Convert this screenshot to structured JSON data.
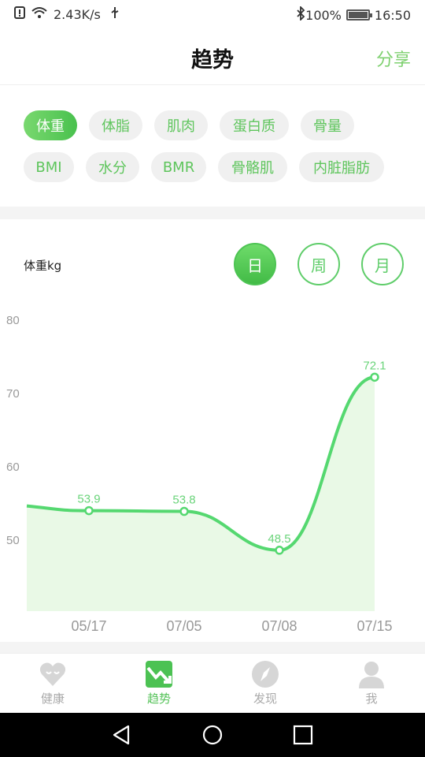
{
  "status_bar": {
    "speed": "2.43K/s",
    "battery": "100%",
    "time": "16:50"
  },
  "header": {
    "title": "趋势",
    "share": "分享"
  },
  "chips": {
    "row1": [
      "体重",
      "体脂",
      "肌肉",
      "蛋白质",
      "骨量"
    ],
    "row2": [
      "BMI",
      "水分",
      "BMR",
      "骨骼肌",
      "内脏脂肪"
    ],
    "active": "体重"
  },
  "chart_header": {
    "label": "体重kg",
    "periods": [
      "日",
      "周",
      "月"
    ],
    "active_period": "日"
  },
  "chart_data": {
    "type": "area",
    "title": "",
    "xlabel": "",
    "ylabel": "体重kg",
    "categories": [
      "05/17",
      "07/05",
      "07/08",
      "07/15"
    ],
    "series": [
      {
        "values": [
          53.9,
          53.8,
          48.5,
          72.1
        ]
      }
    ],
    "y_ticks": [
      80,
      70,
      60,
      50
    ],
    "ylim": [
      40.2,
      80
    ],
    "line_color": "#55d870",
    "fill_color": "#e9f9e6",
    "grid": false
  },
  "tabs": [
    {
      "label": "健康",
      "icon": "heart-icon",
      "active": false
    },
    {
      "label": "趋势",
      "icon": "trend-icon",
      "active": true
    },
    {
      "label": "发现",
      "icon": "compass-icon",
      "active": false
    },
    {
      "label": "我",
      "icon": "person-icon",
      "active": false
    }
  ],
  "colors": {
    "accent": "#56c35a",
    "chip_bg": "#f0f0f0"
  }
}
